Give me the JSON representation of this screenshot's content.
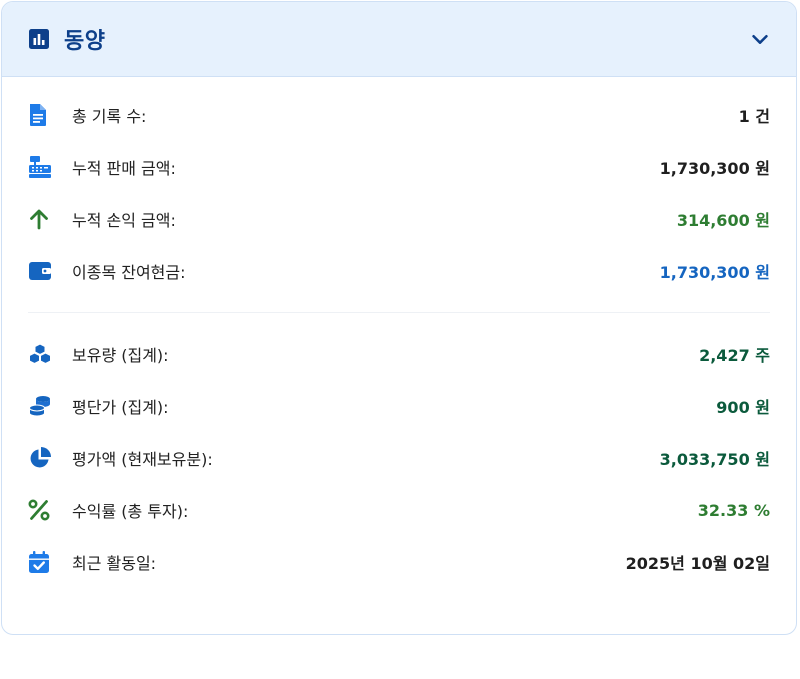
{
  "header": {
    "title": "동양",
    "icon": "bar-chart-icon",
    "toggle_icon": "chevron-down-icon"
  },
  "colors": {
    "header_bg": "#e6f1fd",
    "accent_blue": "#1565c0",
    "title_navy": "#0d3f8a",
    "green": "#2e7d32",
    "dark_green": "#0b5a3c"
  },
  "summary": [
    {
      "icon": "document-icon",
      "label": "총 기록 수:",
      "value": "1 건",
      "color": "#1f1f1f"
    },
    {
      "icon": "cash-register-icon",
      "label": "누적 판매 금액:",
      "value": "1,730,300 원",
      "color": "#1f1f1f"
    },
    {
      "icon": "arrow-up-icon",
      "label": "누적 손익 금액:",
      "value": "314,600 원",
      "color": "#2e7d32"
    },
    {
      "icon": "wallet-icon",
      "label": "이종목 잔여현금:",
      "value": "1,730,300 원",
      "color": "#1565c0"
    }
  ],
  "holdings": [
    {
      "icon": "boxes-icon",
      "label": "보유량 (집계):",
      "value": "2,427 주",
      "color": "#0b5a3c"
    },
    {
      "icon": "coins-icon",
      "label": "평단가 (집계):",
      "value": "900 원",
      "color": "#0b5a3c"
    },
    {
      "icon": "pie-chart-icon",
      "label": "평가액 (현재보유분):",
      "value": "3,033,750 원",
      "color": "#0b5a3c"
    },
    {
      "icon": "percent-icon",
      "label": "수익률 (총 투자):",
      "value": "32.33 %",
      "color": "#2e7d32"
    },
    {
      "icon": "calendar-check-icon",
      "label": "최근 활동일:",
      "value": "2025년 10월 02일",
      "color": "#1f1f1f"
    }
  ]
}
